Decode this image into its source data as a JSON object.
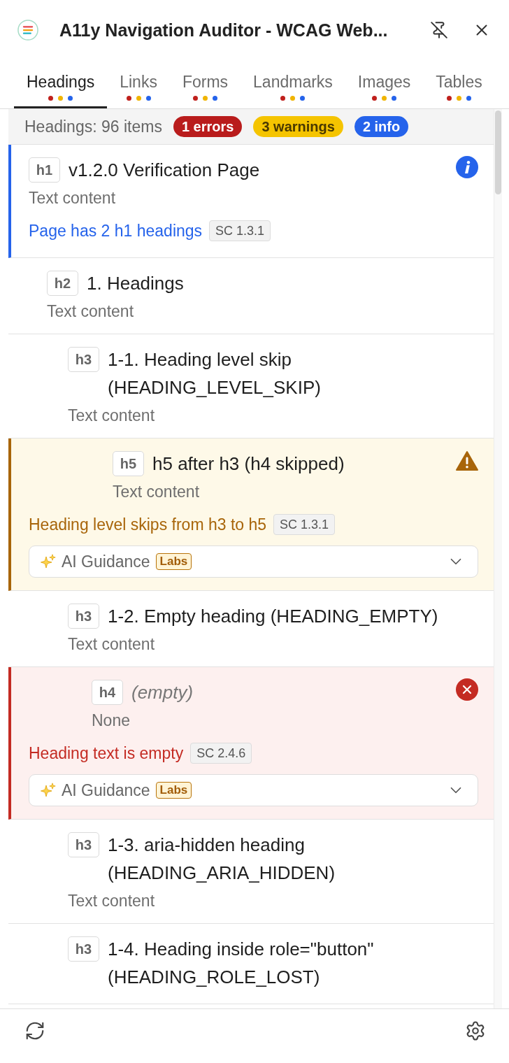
{
  "header": {
    "title": "A11y Navigation Auditor - WCAG Web..."
  },
  "tabs": [
    {
      "label": "Headings",
      "selected": true
    },
    {
      "label": "Links",
      "selected": false
    },
    {
      "label": "Forms",
      "selected": false
    },
    {
      "label": "Landmarks",
      "selected": false
    },
    {
      "label": "Images",
      "selected": false
    },
    {
      "label": "Tables",
      "selected": false
    }
  ],
  "summary": {
    "label": "Headings: 96 items",
    "badges": [
      {
        "kind": "error",
        "text": "1 errors"
      },
      {
        "kind": "warning",
        "text": "3 warnings"
      },
      {
        "kind": "info",
        "text": "2 info"
      }
    ]
  },
  "headings": [
    {
      "kind": "info",
      "tag": "h1",
      "title": "v1.2.0 Verification Page",
      "content": "Text content",
      "issue": {
        "message": "Page has 2 h1 headings",
        "criterion": "SC 1.3.1"
      },
      "children": [
        {
          "kind": "plain",
          "tag": "h2",
          "title": "1. Headings",
          "content": "Text content",
          "children": [
            {
              "kind": "plain",
              "tag": "h3",
              "title": "1-1. Heading level skip (HEADING_LEVEL_SKIP)",
              "content": "Text content",
              "children": [
                {
                  "kind": "warning",
                  "tag": "h5",
                  "title": "h5 after h3 (h4 skipped)",
                  "content": "Text content",
                  "issue": {
                    "message": "Heading level skips from h3 to h5",
                    "criterion": "SC 1.3.1"
                  },
                  "ai_guidance": {
                    "label": "AI Guidance",
                    "badge": "Labs",
                    "expanded": false
                  }
                }
              ]
            },
            {
              "kind": "plain",
              "tag": "h3",
              "title": "1-2. Empty heading (HEADING_EMPTY)",
              "content": "Text content",
              "children": [
                {
                  "kind": "error",
                  "tag": "h4",
                  "title": "(empty)",
                  "empty": true,
                  "content": "None",
                  "issue": {
                    "message": "Heading text is empty",
                    "criterion": "SC 2.4.6"
                  },
                  "ai_guidance": {
                    "label": "AI Guidance",
                    "badge": "Labs",
                    "expanded": false
                  }
                }
              ]
            },
            {
              "kind": "plain",
              "tag": "h3",
              "title": "1-3. aria-hidden heading (HEADING_ARIA_HIDDEN)",
              "content": "Text content"
            },
            {
              "kind": "plain",
              "tag": "h3",
              "title": "1-4. Heading inside role=\"button\" (HEADING_ROLE_LOST)"
            }
          ]
        }
      ]
    }
  ]
}
